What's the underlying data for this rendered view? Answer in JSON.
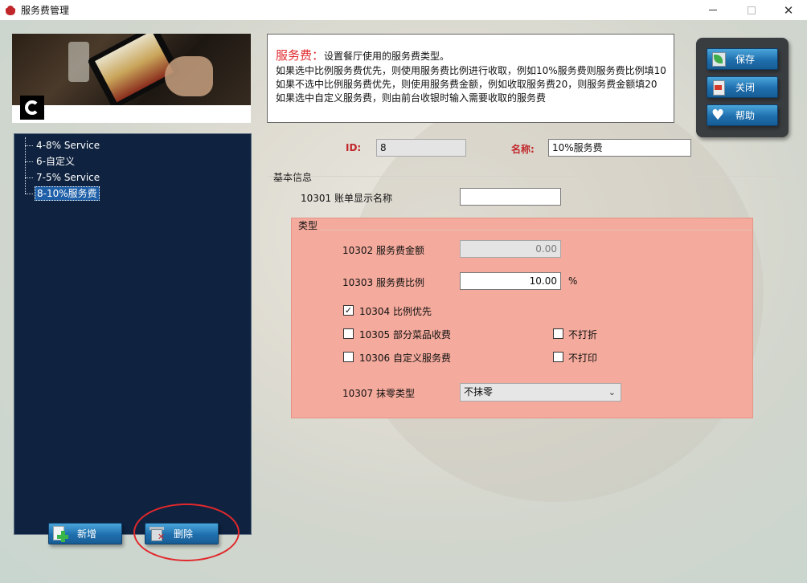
{
  "window": {
    "title": "服务费管理",
    "min_glyph": "",
    "close_glyph": "✕"
  },
  "tree": {
    "items": [
      {
        "label": "4-8% Service",
        "selected": false
      },
      {
        "label": "6-自定义",
        "selected": false
      },
      {
        "label": "7-5% Service",
        "selected": false
      },
      {
        "label": "8-10%服务费",
        "selected": true
      }
    ]
  },
  "left_buttons": {
    "add_label": "新增",
    "delete_label": "删除"
  },
  "info": {
    "heading": "服务费：",
    "heading_desc": "设置餐厅使用的服务费类型。",
    "line1": "如果选中比例服务费优先，则使用服务费比例进行收取，例如10%服务费则服务费比例填10",
    "line2": "如果不选中比例服务费优先，则使用服务费金额，例如收取服务费20，则服务费金额填20",
    "line3": "如果选中自定义服务费，则由前台收银时输入需要收取的服务费"
  },
  "actions": {
    "save_label": "保存",
    "close_label": "关闭",
    "help_label": "帮助"
  },
  "form": {
    "id_label": "ID:",
    "id_value": "8",
    "name_label": "名称:",
    "name_value": "10%服务费",
    "basic_section": "基本信息",
    "bill_name_label": "10301 账单显示名称",
    "bill_name_value": "",
    "type_section": "类型",
    "amount_label": "10302 服务费金额",
    "amount_value": "0.00",
    "ratio_label": "10303 服务费比例",
    "ratio_value": "10.00",
    "ratio_unit": "%",
    "ratio_priority_label": "10304 比例优先",
    "ratio_priority_checked": true,
    "partial_label": "10305 部分菜品收费",
    "partial_checked": false,
    "custom_label": "10306 自定义服务费",
    "custom_checked": false,
    "no_discount_label": "不打折",
    "no_discount_checked": false,
    "no_print_label": "不打印",
    "no_print_checked": false,
    "rounding_label": "10307 抹零类型",
    "rounding_value": "不抹零"
  },
  "colors": {
    "tree_bg": "#0f2340",
    "type_bg": "#f4aa9c",
    "button_blue": "#1f6fae",
    "highlight_red": "#e0282c"
  }
}
